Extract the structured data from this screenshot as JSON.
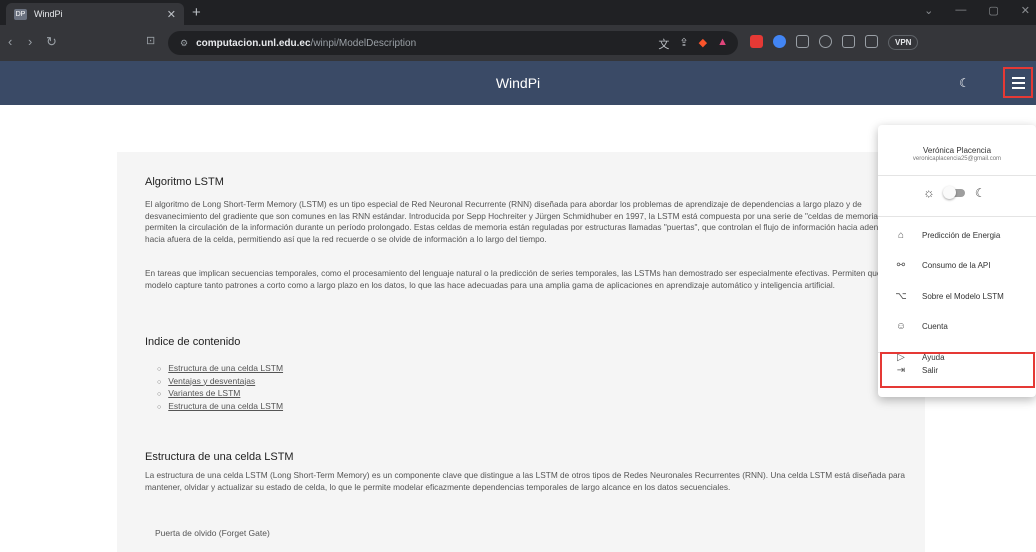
{
  "browser": {
    "tab_title": "WindPi",
    "tab_favicon": "DP",
    "url_host": "computacion.unl.edu.ec",
    "url_path": "/winpi/ModelDescription",
    "vpn_label": "VPN"
  },
  "app": {
    "title": "WindPi"
  },
  "content": {
    "section1_title": "Algoritmo LSTM",
    "section1_para": "El algoritmo de Long Short-Term Memory (LSTM) es un tipo especial de Red Neuronal Recurrente (RNN) diseñada para abordar los problemas de aprendizaje de dependencias a largo plazo y de desvanecimiento del gradiente que son comunes en las RNN estándar. Introducida por Sepp Hochreiter y Jürgen Schmidhuber en 1997, la LSTM está compuesta por una serie de \"celdas de memoria\" que permiten la circulación de la información durante un período prolongado. Estas celdas de memoria están reguladas por estructuras llamadas \"puertas\", que controlan el flujo de información hacia adentro y hacia afuera de la celda, permitiendo así que la red recuerde o se olvide de información a lo largo del tiempo.",
    "section1_para2": "En tareas que implican secuencias temporales, como el procesamiento del lenguaje natural o la predicción de series temporales, las LSTMs han demostrado ser especialmente efectivas. Permiten que el modelo capture tanto patrones a corto como a largo plazo en los datos, lo que las hace adecuadas para una amplia gama de aplicaciones en aprendizaje automático y inteligencia artificial.",
    "toc_title": "Indice de contenido",
    "toc_items": [
      "Estructura de una celda LSTM",
      "Ventajas y desventajas",
      "Variantes de LSTM",
      "Estructura de una celda LSTM"
    ],
    "section2_title": "Estructura de una celda LSTM",
    "section2_para": "La estructura de una celda LSTM (Long Short-Term Memory) es un componente clave que distingue a las LSTM de otros tipos de Redes Neuronales Recurrentes (RNN). Una celda LSTM está diseñada para mantener, olvidar y actualizar su estado de celda, lo que le permite modelar eficazmente dependencias temporales de largo alcance en los datos secuenciales.",
    "subsection_title": "Puerta de olvido (Forget Gate)"
  },
  "menu": {
    "user_name": "Verónica Placencia",
    "user_email": "veronicaplacencia25@gmail.com",
    "items": [
      {
        "label": "Predicción de Energia",
        "icon": "home-icon"
      },
      {
        "label": "Consumo de la API",
        "icon": "api-icon"
      },
      {
        "label": "Sobre el Modelo LSTM",
        "icon": "model-icon"
      },
      {
        "label": "Cuenta",
        "icon": "account-icon"
      },
      {
        "label": "Ayuda",
        "icon": "help-icon"
      }
    ],
    "logout_label": "Salir"
  },
  "colors": {
    "appbar": "#3a4a66",
    "highlight": "#e53935",
    "content_bg": "#f5f5f5"
  }
}
